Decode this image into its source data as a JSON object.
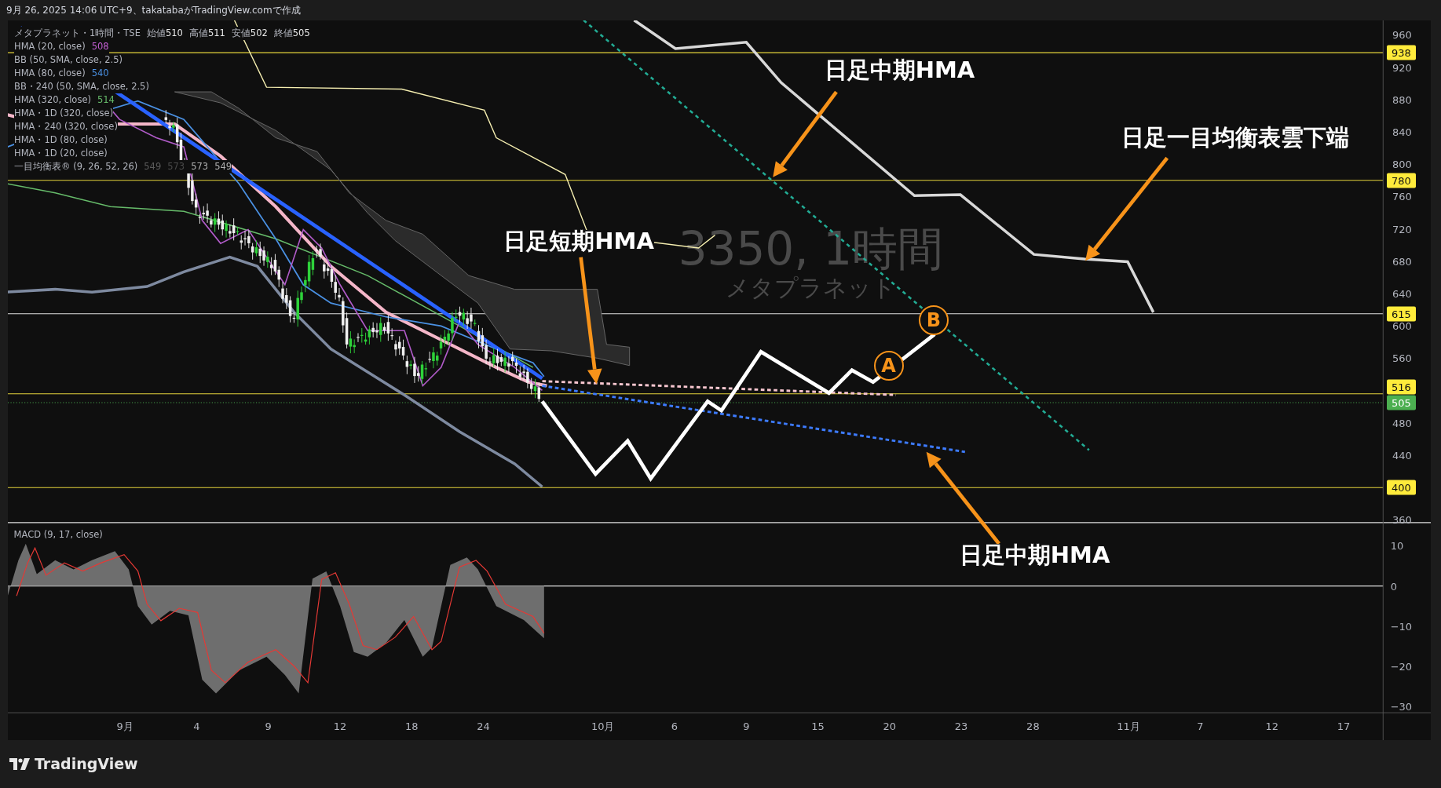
{
  "header": {
    "text": "9月 26, 2025 14:06 UTC+9、takatabaがTradingView.comで作成"
  },
  "legend": {
    "symbol": "メタプラネット・1時間・TSE",
    "ohlc": [
      {
        "label": "始値",
        "value": "510"
      },
      {
        "label": "高値",
        "value": "511"
      },
      {
        "label": "安値",
        "value": "502"
      },
      {
        "label": "終値",
        "value": "505"
      }
    ],
    "indicators": [
      {
        "name": "HMA (20, close)",
        "values": [
          {
            "text": "508",
            "color": "#c25fd1"
          }
        ]
      },
      {
        "name": "BB (50, SMA, close, 2.5)"
      },
      {
        "name": "HMA (80, close)",
        "values": [
          {
            "text": "540",
            "color": "#4a90e2"
          }
        ]
      },
      {
        "name": "BB・240 (50, SMA, close, 2.5)"
      },
      {
        "name": "HMA (320, close)",
        "values": [
          {
            "text": "514",
            "color": "#66bb6a"
          }
        ]
      },
      {
        "name": "HMA・1D (320, close)"
      },
      {
        "name": "HMA・240 (320, close)"
      },
      {
        "name": "HMA・1D (80, close)"
      },
      {
        "name": "HMA・1D (20, close)"
      },
      {
        "name": "一目均衡表® (9, 26, 52, 26)",
        "values": [
          {
            "text": "549",
            "color": "#5c5c5c"
          },
          {
            "text": "573",
            "color": "#4a4a4a"
          },
          {
            "text": "573",
            "color": "#b0b0b0"
          },
          {
            "text": "549",
            "color": "#b0b0b0"
          }
        ]
      }
    ]
  },
  "watermark": {
    "title": "3350, 1時間",
    "subtitle": "メタプラネット"
  },
  "annotations": [
    {
      "text": "日足中期HMA"
    },
    {
      "text": "日足一目均衡表雲下端"
    },
    {
      "text": "日足短期HMA"
    },
    {
      "text": "日足中期HMA"
    }
  ],
  "wave_markers": [
    {
      "label": "A"
    },
    {
      "label": "B"
    }
  ],
  "price_axis": {
    "ticks": [
      "960",
      "920",
      "880",
      "840",
      "800",
      "760",
      "720",
      "680",
      "640",
      "600",
      "560",
      "480",
      "440",
      "360"
    ],
    "badges": [
      {
        "text": "938",
        "kind": "line"
      },
      {
        "text": "780",
        "kind": "line"
      },
      {
        "text": "615",
        "kind": "line"
      },
      {
        "text": "516",
        "kind": "line"
      },
      {
        "text": "505",
        "kind": "last_price"
      },
      {
        "text": "400",
        "kind": "line"
      }
    ]
  },
  "macd": {
    "title": "MACD (9, 17, close)",
    "ticks": [
      "10",
      "0",
      "−10",
      "−20",
      "−30"
    ]
  },
  "time_axis": {
    "labels": [
      "9月",
      "4",
      "9",
      "12",
      "18",
      "24",
      "10月",
      "6",
      "9",
      "15",
      "20",
      "23",
      "28",
      "11月",
      "7",
      "12",
      "17"
    ]
  },
  "footer": {
    "brand": "TradingView"
  }
}
